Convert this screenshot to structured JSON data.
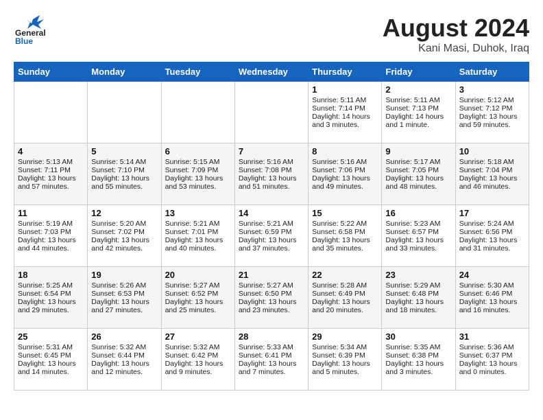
{
  "header": {
    "logo_general": "General",
    "logo_blue": "Blue",
    "month_title": "August 2024",
    "location": "Kani Masi, Duhok, Iraq"
  },
  "days_of_week": [
    "Sunday",
    "Monday",
    "Tuesday",
    "Wednesday",
    "Thursday",
    "Friday",
    "Saturday"
  ],
  "weeks": [
    {
      "days": [
        {
          "num": "",
          "info": ""
        },
        {
          "num": "",
          "info": ""
        },
        {
          "num": "",
          "info": ""
        },
        {
          "num": "",
          "info": ""
        },
        {
          "num": "1",
          "sunrise": "5:11 AM",
          "sunset": "7:14 PM",
          "daylight": "14 hours and 3 minutes."
        },
        {
          "num": "2",
          "sunrise": "5:11 AM",
          "sunset": "7:13 PM",
          "daylight": "14 hours and 1 minute."
        },
        {
          "num": "3",
          "sunrise": "5:12 AM",
          "sunset": "7:12 PM",
          "daylight": "13 hours and 59 minutes."
        }
      ]
    },
    {
      "days": [
        {
          "num": "4",
          "sunrise": "5:13 AM",
          "sunset": "7:11 PM",
          "daylight": "13 hours and 57 minutes."
        },
        {
          "num": "5",
          "sunrise": "5:14 AM",
          "sunset": "7:10 PM",
          "daylight": "13 hours and 55 minutes."
        },
        {
          "num": "6",
          "sunrise": "5:15 AM",
          "sunset": "7:09 PM",
          "daylight": "13 hours and 53 minutes."
        },
        {
          "num": "7",
          "sunrise": "5:16 AM",
          "sunset": "7:08 PM",
          "daylight": "13 hours and 51 minutes."
        },
        {
          "num": "8",
          "sunrise": "5:16 AM",
          "sunset": "7:06 PM",
          "daylight": "13 hours and 49 minutes."
        },
        {
          "num": "9",
          "sunrise": "5:17 AM",
          "sunset": "7:05 PM",
          "daylight": "13 hours and 48 minutes."
        },
        {
          "num": "10",
          "sunrise": "5:18 AM",
          "sunset": "7:04 PM",
          "daylight": "13 hours and 46 minutes."
        }
      ]
    },
    {
      "days": [
        {
          "num": "11",
          "sunrise": "5:19 AM",
          "sunset": "7:03 PM",
          "daylight": "13 hours and 44 minutes."
        },
        {
          "num": "12",
          "sunrise": "5:20 AM",
          "sunset": "7:02 PM",
          "daylight": "13 hours and 42 minutes."
        },
        {
          "num": "13",
          "sunrise": "5:21 AM",
          "sunset": "7:01 PM",
          "daylight": "13 hours and 40 minutes."
        },
        {
          "num": "14",
          "sunrise": "5:21 AM",
          "sunset": "6:59 PM",
          "daylight": "13 hours and 37 minutes."
        },
        {
          "num": "15",
          "sunrise": "5:22 AM",
          "sunset": "6:58 PM",
          "daylight": "13 hours and 35 minutes."
        },
        {
          "num": "16",
          "sunrise": "5:23 AM",
          "sunset": "6:57 PM",
          "daylight": "13 hours and 33 minutes."
        },
        {
          "num": "17",
          "sunrise": "5:24 AM",
          "sunset": "6:56 PM",
          "daylight": "13 hours and 31 minutes."
        }
      ]
    },
    {
      "days": [
        {
          "num": "18",
          "sunrise": "5:25 AM",
          "sunset": "6:54 PM",
          "daylight": "13 hours and 29 minutes."
        },
        {
          "num": "19",
          "sunrise": "5:26 AM",
          "sunset": "6:53 PM",
          "daylight": "13 hours and 27 minutes."
        },
        {
          "num": "20",
          "sunrise": "5:27 AM",
          "sunset": "6:52 PM",
          "daylight": "13 hours and 25 minutes."
        },
        {
          "num": "21",
          "sunrise": "5:27 AM",
          "sunset": "6:50 PM",
          "daylight": "13 hours and 23 minutes."
        },
        {
          "num": "22",
          "sunrise": "5:28 AM",
          "sunset": "6:49 PM",
          "daylight": "13 hours and 20 minutes."
        },
        {
          "num": "23",
          "sunrise": "5:29 AM",
          "sunset": "6:48 PM",
          "daylight": "13 hours and 18 minutes."
        },
        {
          "num": "24",
          "sunrise": "5:30 AM",
          "sunset": "6:46 PM",
          "daylight": "13 hours and 16 minutes."
        }
      ]
    },
    {
      "days": [
        {
          "num": "25",
          "sunrise": "5:31 AM",
          "sunset": "6:45 PM",
          "daylight": "13 hours and 14 minutes."
        },
        {
          "num": "26",
          "sunrise": "5:32 AM",
          "sunset": "6:44 PM",
          "daylight": "13 hours and 12 minutes."
        },
        {
          "num": "27",
          "sunrise": "5:32 AM",
          "sunset": "6:42 PM",
          "daylight": "13 hours and 9 minutes."
        },
        {
          "num": "28",
          "sunrise": "5:33 AM",
          "sunset": "6:41 PM",
          "daylight": "13 hours and 7 minutes."
        },
        {
          "num": "29",
          "sunrise": "5:34 AM",
          "sunset": "6:39 PM",
          "daylight": "13 hours and 5 minutes."
        },
        {
          "num": "30",
          "sunrise": "5:35 AM",
          "sunset": "6:38 PM",
          "daylight": "13 hours and 3 minutes."
        },
        {
          "num": "31",
          "sunrise": "5:36 AM",
          "sunset": "6:37 PM",
          "daylight": "13 hours and 0 minutes."
        }
      ]
    }
  ]
}
